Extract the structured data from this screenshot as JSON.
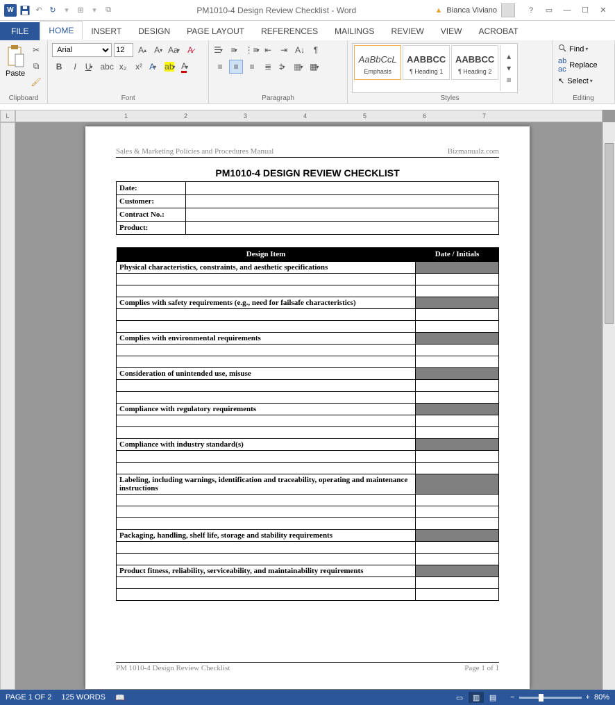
{
  "titlebar": {
    "title": "PM1010-4 Design Review Checklist - Word",
    "user": "Bianca Viviano"
  },
  "tabs": {
    "file": "FILE",
    "home": "HOME",
    "insert": "INSERT",
    "design": "DESIGN",
    "page_layout": "PAGE LAYOUT",
    "references": "REFERENCES",
    "mailings": "MAILINGS",
    "review": "REVIEW",
    "view": "VIEW",
    "acrobat": "ACROBAT"
  },
  "clipboard": {
    "paste": "Paste",
    "label": "Clipboard"
  },
  "font": {
    "name": "Arial",
    "size": "12",
    "label": "Font"
  },
  "paragraph": {
    "label": "Paragraph"
  },
  "styles": {
    "label": "Styles",
    "items": [
      {
        "preview": "AaBbCcL",
        "name": "Emphasis",
        "em": true
      },
      {
        "preview": "AABBCC",
        "name": "¶ Heading 1",
        "bold": true
      },
      {
        "preview": "AABBCC",
        "name": "¶ Heading 2",
        "bold": true
      }
    ]
  },
  "editing": {
    "find": "Find",
    "replace": "Replace",
    "select": "Select",
    "label": "Editing"
  },
  "ruler_corner": "L",
  "document": {
    "header_left": "Sales & Marketing Policies and Procedures Manual",
    "header_right": "Bizmanualz.com",
    "title": "PM1010-4 DESIGN REVIEW CHECKLIST",
    "meta": [
      "Date:",
      "Customer:",
      "Contract No.:",
      "Product:"
    ],
    "col1": "Design Item",
    "col2": "Date / Initials",
    "items": [
      "Physical characteristics, constraints, and aesthetic specifications",
      "Complies with safety requirements (e.g., need for failsafe characteristics)",
      "Complies with environmental requirements",
      "Consideration of unintended use, misuse",
      "Compliance with regulatory requirements",
      "Compliance with industry standard(s)",
      "Labeling, including warnings, identification and traceability, operating and maintenance instructions",
      "Packaging, handling, shelf life, storage and stability requirements",
      "Product fitness, reliability, serviceability, and maintainability requirements"
    ],
    "footer_left": "PM 1010-4 Design Review Checklist",
    "footer_right": "Page 1 of 1"
  },
  "status": {
    "page": "PAGE 1 OF 2",
    "words": "125 WORDS",
    "zoom": "80%"
  }
}
